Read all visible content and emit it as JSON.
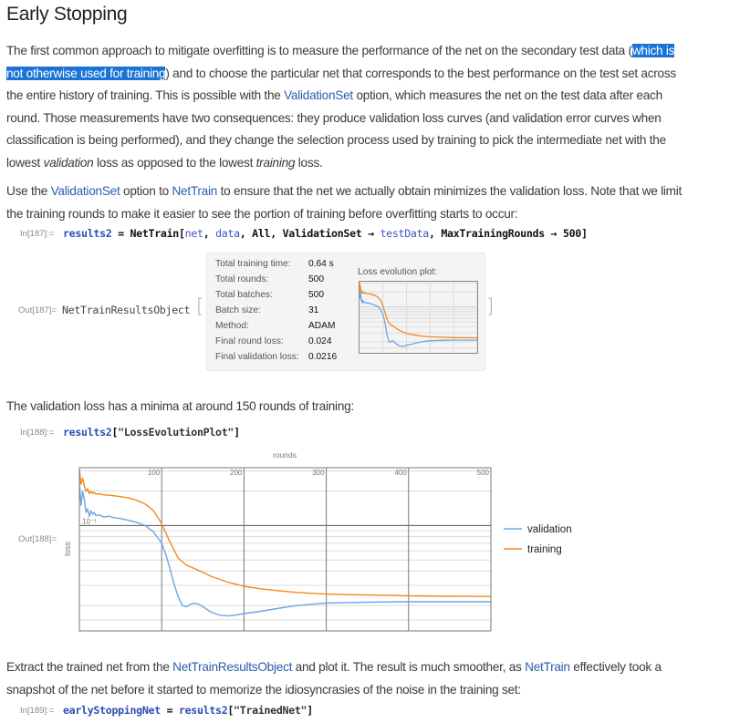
{
  "section": {
    "title": "Early Stopping"
  },
  "paragraph1": {
    "before_hl": "The first common approach to mitigate overfitting is to measure the performance of the net on the secondary test data (",
    "hl_line1": "which is",
    "hl_line2": "not otherwise used for training",
    "after_hl": ") and to choose the particular net that corresponds to the best performance on the test set across",
    "line3_a": "the entire history of training. This is possible with the ",
    "line3_link": "ValidationSet",
    "line3_b": " option, which measures the net on the test data after each",
    "line4": "round. Those measurements have two consequences: they produce validation loss curves (and validation error curves when",
    "line5": "classification is being performed), and they change the selection process used by training to pick the intermediate net with the",
    "line6_a": "lowest ",
    "line6_i1": "validation",
    "line6_b": " loss as opposed to the lowest ",
    "line6_i2": "training",
    "line6_c": " loss."
  },
  "paragraph2": {
    "a": "Use the ",
    "link1": "ValidationSet",
    "b": " option to ",
    "link2": "NetTrain",
    "c": " to ensure that the net we actually obtain minimizes the validation loss. Note that we limit",
    "line2": "the training rounds to make it easier to see the portion of training before overfitting starts to occur:"
  },
  "cell187": {
    "in_label": "In[187]:=",
    "code": {
      "t1": "results2",
      "t2": " = ",
      "t3": "NetTrain",
      "t4": "[",
      "t5": "net",
      "t6": ", ",
      "t7": "data",
      "t8": ", ",
      "t9": "All",
      "t10": ", ",
      "t11": "ValidationSet",
      "t12": " → ",
      "t13": "testData",
      "t14": ", ",
      "t15": "MaxTrainingRounds",
      "t16": " → ",
      "t17": "500",
      "t18": "]"
    },
    "out_label": "Out[187]=",
    "out_head": "NetTrainResultsObject",
    "bracket_open": "[",
    "bracket_close": "]",
    "summary": {
      "rows": [
        {
          "label": "Total training time:",
          "value": "0.64 s"
        },
        {
          "label": "Total rounds:",
          "value": "500"
        },
        {
          "label": "Total batches:",
          "value": "500"
        },
        {
          "label": "Batch size:",
          "value": "31"
        },
        {
          "label": "Method:",
          "value": "ADAM"
        },
        {
          "label": "Final round loss:",
          "value": "0.024"
        },
        {
          "label": "Final validation loss:",
          "value": "0.0216"
        }
      ],
      "plot_label": "Loss evolution plot:"
    }
  },
  "paragraph3": {
    "text": "The validation loss has a minima at around 150 rounds of training:"
  },
  "cell188": {
    "in_label": "In[188]:=",
    "code": {
      "t1": "results2",
      "t2": "[",
      "t3": "\"LossEvolutionPlot\"",
      "t4": "]"
    },
    "out_label": "Out[188]="
  },
  "paragraph4": {
    "a": "Extract the trained net from the ",
    "link1": "NetTrainResultsObject",
    "b": " and plot it. The result is much smoother, as ",
    "link2": "NetTrain",
    "c": " effectively took a",
    "line2": "snapshot of the net before it started to memorize the idiosyncrasies of the noise in the training set:"
  },
  "cell189": {
    "in_label": "In[189]:=",
    "code": {
      "t1": "earlyStoppingNet",
      "t2": " = ",
      "t3": "results2",
      "t4": "[",
      "t5": "\"TrainedNet\"",
      "t6": "]"
    }
  },
  "colors": {
    "validation": "#6fa6e2",
    "training": "#f28a1c",
    "link": "#2a5db0",
    "highlight": "#1a73d6"
  },
  "chart_data": {
    "type": "line",
    "title": "",
    "xlabel": "rounds",
    "ylabel": "loss",
    "xlim": [
      0,
      500
    ],
    "yscale": "log",
    "ylim": [
      0.012,
      0.32
    ],
    "x_ticks": [
      "100",
      "200",
      "300",
      "400",
      "500"
    ],
    "x_tick_values": [
      100,
      200,
      300,
      400,
      500
    ],
    "y_tick_labels": [
      "10⁻¹"
    ],
    "y_tick_values": [
      0.1
    ],
    "grid": true,
    "legend_position": "right",
    "series": [
      {
        "name": "validation",
        "x": [
          0,
          2,
          4,
          6,
          8,
          10,
          12,
          14,
          16,
          18,
          20,
          24,
          28,
          32,
          36,
          40,
          50,
          60,
          70,
          80,
          90,
          100,
          105,
          110,
          115,
          120,
          125,
          130,
          135,
          140,
          145,
          150,
          155,
          160,
          170,
          180,
          190,
          200,
          220,
          240,
          260,
          280,
          300,
          350,
          400,
          450,
          500
        ],
        "y": [
          0.24,
          0.15,
          0.2,
          0.17,
          0.13,
          0.14,
          0.12,
          0.135,
          0.125,
          0.13,
          0.122,
          0.124,
          0.12,
          0.119,
          0.121,
          0.118,
          0.115,
          0.111,
          0.106,
          0.1,
          0.088,
          0.07,
          0.056,
          0.042,
          0.031,
          0.024,
          0.02,
          0.0195,
          0.0205,
          0.021,
          0.0205,
          0.0195,
          0.0185,
          0.0175,
          0.0165,
          0.0162,
          0.0165,
          0.017,
          0.0178,
          0.0188,
          0.0198,
          0.0205,
          0.021,
          0.0214,
          0.0216,
          0.0216,
          0.0216
        ]
      },
      {
        "name": "training",
        "x": [
          0,
          2,
          4,
          6,
          8,
          10,
          12,
          14,
          16,
          18,
          20,
          24,
          28,
          32,
          36,
          40,
          50,
          60,
          70,
          80,
          90,
          100,
          110,
          120,
          130,
          140,
          150,
          160,
          180,
          200,
          220,
          240,
          260,
          280,
          300,
          350,
          400,
          450,
          500
        ],
        "y": [
          0.31,
          0.23,
          0.26,
          0.22,
          0.2,
          0.21,
          0.19,
          0.2,
          0.19,
          0.195,
          0.188,
          0.19,
          0.186,
          0.185,
          0.184,
          0.183,
          0.179,
          0.174,
          0.166,
          0.154,
          0.135,
          0.104,
          0.072,
          0.052,
          0.045,
          0.042,
          0.039,
          0.036,
          0.032,
          0.0295,
          0.028,
          0.027,
          0.0262,
          0.0256,
          0.0252,
          0.0247,
          0.0243,
          0.0241,
          0.024
        ]
      }
    ]
  }
}
